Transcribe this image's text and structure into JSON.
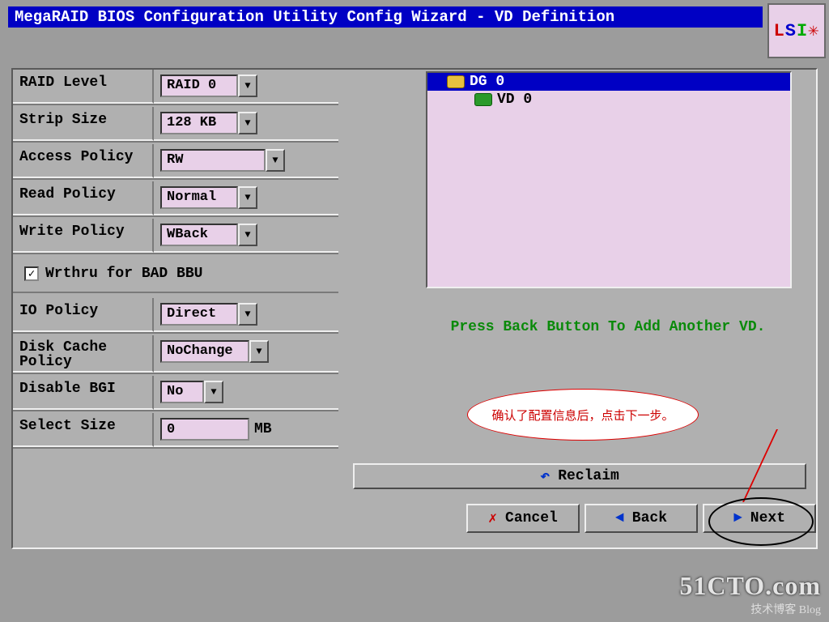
{
  "title": "MegaRAID BIOS Configuration Utility Config Wizard - VD Definition",
  "logo": "LSI",
  "form": {
    "raid_level": {
      "label": "RAID Level",
      "value": "RAID 0"
    },
    "strip_size": {
      "label": "Strip Size",
      "value": "128 KB"
    },
    "access_policy": {
      "label": "Access Policy",
      "value": "RW"
    },
    "read_policy": {
      "label": "Read Policy",
      "value": "Normal"
    },
    "write_policy": {
      "label": "Write Policy",
      "value": "WBack"
    },
    "wrthru_bad_bbu": {
      "label": "Wrthru for BAD BBU",
      "checked": true
    },
    "io_policy": {
      "label": "IO Policy",
      "value": "Direct"
    },
    "disk_cache_policy": {
      "label": "Disk Cache Policy",
      "value": "NoChange"
    },
    "disable_bgi": {
      "label": "Disable BGI",
      "value": "No"
    },
    "select_size": {
      "label": "Select Size",
      "value": "0",
      "unit": "MB"
    }
  },
  "tree": {
    "dg": "DG 0",
    "vd": "VD 0"
  },
  "hint": "Press Back Button To Add Another VD.",
  "buttons": {
    "reclaim": "Reclaim",
    "cancel": "Cancel",
    "back": "Back",
    "next": "Next"
  },
  "callout": "确认了配置信息后，点击下一步。",
  "watermark": {
    "big": "51CTO.com",
    "small": "技术博客  Blog"
  }
}
